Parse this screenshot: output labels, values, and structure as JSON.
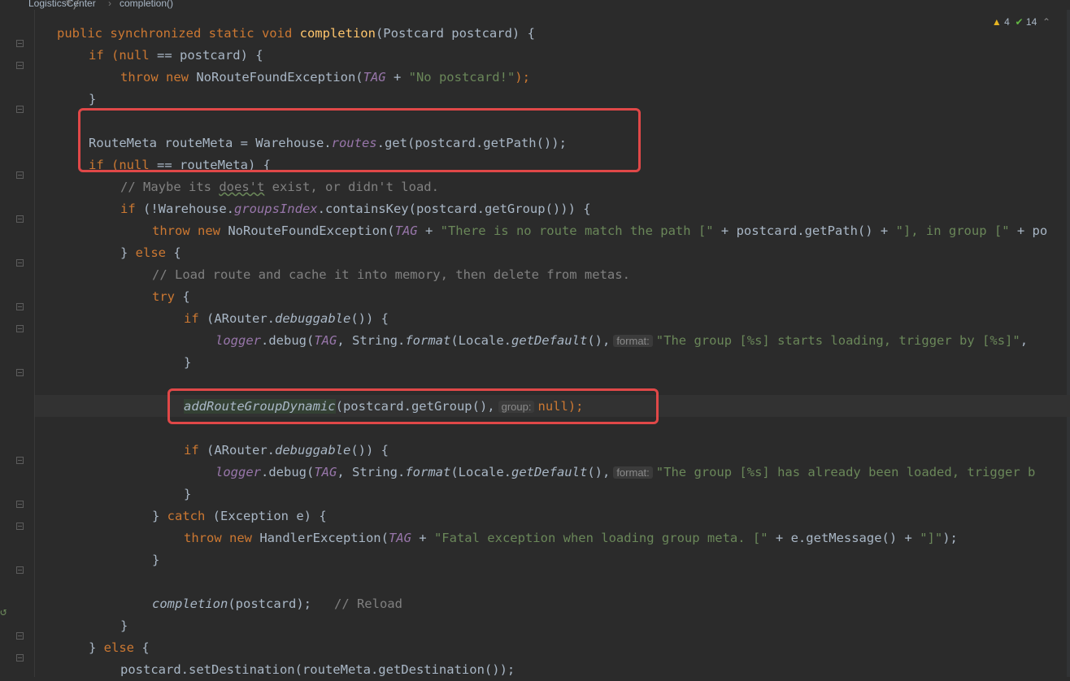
{
  "breadcrumb": {
    "class": "LogisticsCenter",
    "separator": "›",
    "method": "completion()"
  },
  "inspections": {
    "warnings": "4",
    "ok": "14",
    "warn_icon": "warning-triangle-icon",
    "ok_icon": "check-icon"
  },
  "code": {
    "l0": "*/",
    "l1": {
      "a": "public synchronized static void ",
      "b": "completion",
      "c": "(Postcard postcard) {"
    },
    "l2": {
      "a": "if (",
      "b": "null",
      "c": " == postcard) {"
    },
    "l3": {
      "a": "throw new ",
      "b": "NoRouteFoundException(",
      "c": "TAG",
      "d": " + ",
      "e": "\"No postcard!\"",
      "f": ");"
    },
    "l4": "}",
    "l5": {
      "a": "RouteMeta routeMeta = Warehouse.",
      "b": "routes",
      "c": ".get(postcard.getPath());"
    },
    "l6": {
      "a": "if (",
      "b": "null",
      "c": " == routeMeta) {"
    },
    "l7": {
      "a": "// Maybe its ",
      "b": "does't",
      "c": " exist, or didn't load."
    },
    "l8": {
      "a": "if ",
      "b": "(!Warehouse.",
      "c": "groupsIndex",
      "d": ".containsKey(postcard.getGroup())) {"
    },
    "l9": {
      "a": "throw new ",
      "b": "NoRouteFoundException(",
      "c": "TAG",
      "d": " + ",
      "e": "\"There is no route match the path [\"",
      "f": " + postcard.getPath() + ",
      "g": "\"], in group [\"",
      "h": " + po"
    },
    "l10": {
      "a": "} ",
      "b": "else",
      "c": " {"
    },
    "l11": "// Load route and cache it into memory, then delete from metas.",
    "l12": {
      "a": "try",
      "b": " {"
    },
    "l13": {
      "a": "if ",
      "b": "(ARouter.",
      "c": "debuggable",
      "d": "()) {"
    },
    "l14": {
      "a": "logger",
      "b": ".debug(",
      "c": "TAG",
      "d": ", String.",
      "e": "format",
      "f": "(Locale.",
      "g": "getDefault",
      "h": "(),",
      "hint": "format:",
      "i": "\"The group [%s] starts loading, trigger by [%s]\"",
      "j": ","
    },
    "l15": "}",
    "l16": {
      "a": "addRouteGroupDynamic",
      "b": "(postcard.getGroup(),",
      "hint": "group:",
      "c": "null",
      "d": ");"
    },
    "l17": {
      "a": "if ",
      "b": "(ARouter.",
      "c": "debuggable",
      "d": "()) {"
    },
    "l18": {
      "a": "logger",
      "b": ".debug(",
      "c": "TAG",
      "d": ", String.",
      "e": "format",
      "f": "(Locale.",
      "g": "getDefault",
      "h": "(),",
      "hint": "format:",
      "i": "\"The group [%s] has already been loaded, trigger b"
    },
    "l19": "}",
    "l20": {
      "a": "} ",
      "b": "catch",
      "c": " (Exception e) {"
    },
    "l21": {
      "a": "throw new ",
      "b": "HandlerException(",
      "c": "TAG",
      "d": " + ",
      "e": "\"Fatal exception when loading group meta. [\"",
      "f": " + e.getMessage() + ",
      "g": "\"]\"",
      "h": ");"
    },
    "l22": "}",
    "l23": {
      "a": "completion",
      "b": "(postcard);",
      "c": "// Reload"
    },
    "l24": "}",
    "l25": {
      "a": "} ",
      "b": "else",
      "c": " {"
    },
    "l26": "postcard.setDestination(routeMeta.getDestination());"
  },
  "colors": {
    "highlight_box": "#e04848",
    "keyword": "#cc7832",
    "string": "#6a8759",
    "function": "#ffc66d"
  }
}
